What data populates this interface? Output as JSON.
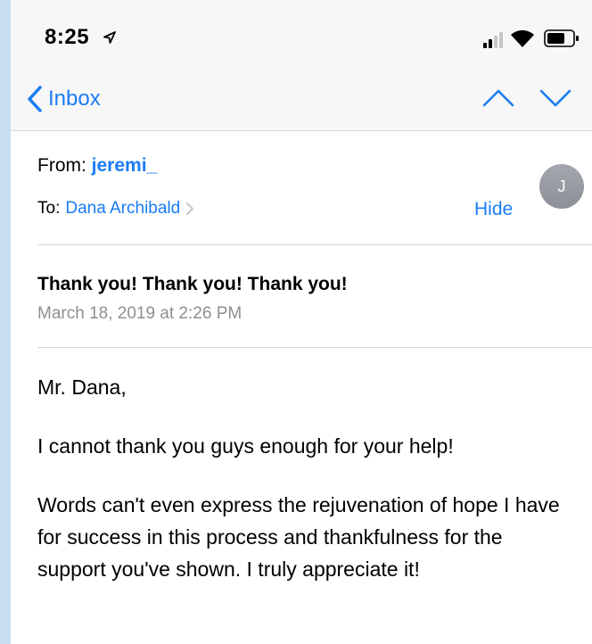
{
  "status_bar": {
    "time": "8:25"
  },
  "nav": {
    "back_label": "Inbox",
    "icons": [
      "chevron-left-icon",
      "chevron-up-icon",
      "chevron-down-icon"
    ]
  },
  "header": {
    "from_label": "From:",
    "from_name": "jeremi_",
    "to_label": "To:",
    "to_name": "Dana Archibald",
    "hide_label": "Hide",
    "avatar_initial": "J"
  },
  "message": {
    "subject": "Thank you! Thank you! Thank you!",
    "date": "March 18, 2019 at 2:26 PM",
    "greeting": "Mr. Dana,",
    "paragraph_1": "I cannot thank you guys enough for your help!",
    "paragraph_2": "Words can't even express the rejuvenation of hope I have for success in this process and thankfulness for the support you've shown. I truly appreciate it!"
  },
  "colors": {
    "accent": "#1a7cf5",
    "secondary_text": "#8e8e93",
    "bar_background": "#f7f7f7",
    "avatar": "#9a9da4"
  }
}
